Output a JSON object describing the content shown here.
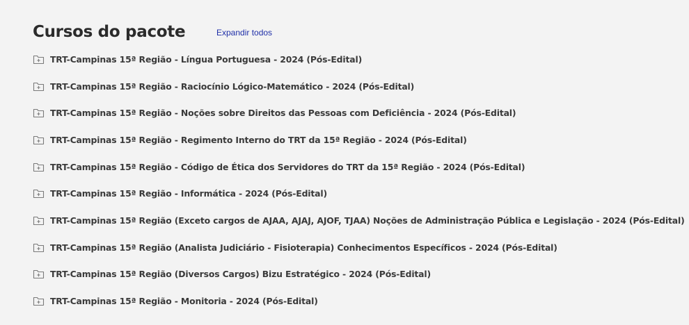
{
  "section": {
    "title": "Cursos do pacote",
    "expand_all_label": "Expandir todos"
  },
  "courses": [
    {
      "label": "TRT-Campinas 15ª Região - Língua Portuguesa - 2024 (Pós-Edital)",
      "icon": "folder-plus-icon"
    },
    {
      "label": "TRT-Campinas 15ª Região - Raciocínio Lógico-Matemático - 2024 (Pós-Edital)",
      "icon": "folder-plus-icon"
    },
    {
      "label": "TRT-Campinas 15ª Região - Noções sobre Direitos das Pessoas com Deficiência - 2024 (Pós-Edital)",
      "icon": "folder-plus-icon"
    },
    {
      "label": "TRT-Campinas 15ª Região - Regimento Interno do TRT da 15ª Região - 2024 (Pós-Edital)",
      "icon": "folder-plus-icon"
    },
    {
      "label": "TRT-Campinas 15ª Região - Código de Ética dos Servidores do TRT da 15ª Região - 2024 (Pós-Edital)",
      "icon": "folder-plus-icon"
    },
    {
      "label": "TRT-Campinas 15ª Região - Informática - 2024 (Pós-Edital)",
      "icon": "folder-plus-icon"
    },
    {
      "label": "TRT-Campinas 15ª Região (Exceto cargos de AJAA, AJAJ, AJOF, TJAA) Noções de Administração Pública e Legislação - 2024 (Pós-Edital)",
      "icon": "folder-plus-icon"
    },
    {
      "label": "TRT-Campinas 15ª Região (Analista Judiciário - Fisioterapia) Conhecimentos Específicos - 2024 (Pós-Edital)",
      "icon": "folder-plus-icon"
    },
    {
      "label": "TRT-Campinas 15ª Região (Diversos Cargos) Bizu Estratégico - 2024 (Pós-Edital)",
      "icon": "folder-plus-icon"
    },
    {
      "label": "TRT-Campinas 15ª Região - Monitoria - 2024 (Pós-Edital)",
      "icon": "folder-plus-icon"
    }
  ],
  "colors": {
    "background": "#f3f3f3",
    "title": "#2b2b2b",
    "link": "#1f2fa8",
    "item_text": "#3a3a3a",
    "icon": "#7a7a7a"
  }
}
